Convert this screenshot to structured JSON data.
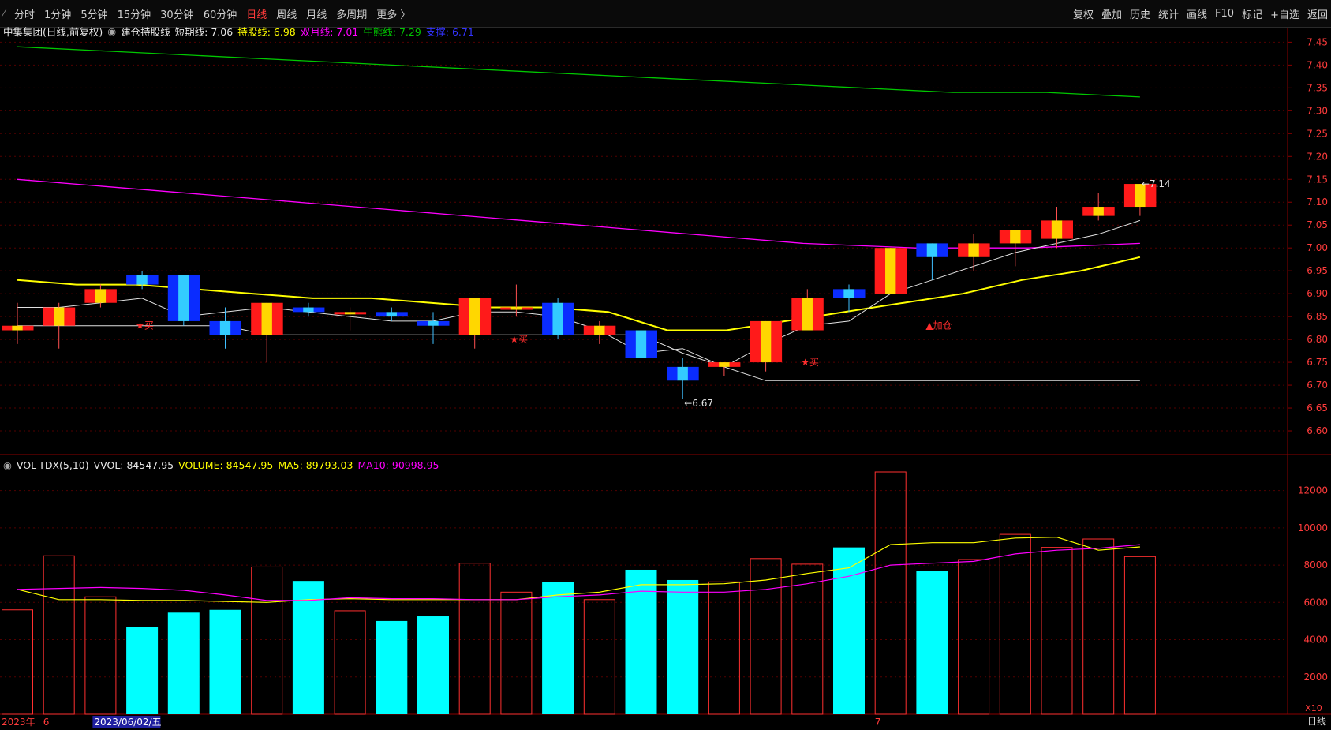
{
  "toolbar": {
    "menu_icon": "pin-icon",
    "left": [
      "分时",
      "1分钟",
      "5分钟",
      "15分钟",
      "30分钟",
      "60分钟",
      "日线",
      "周线",
      "月线",
      "多周期",
      "更多 〉"
    ],
    "active": "日线",
    "right": [
      "复权",
      "叠加",
      "历史",
      "统计",
      "画线",
      "F10",
      "标记",
      "+自选",
      "返回"
    ]
  },
  "price_legend": {
    "name": "中集集团(日线,前复权)",
    "indicator": "建仓持股线",
    "short": "短期线: 7.06",
    "hold": "持股线: 6.98",
    "double_month": "双月线: 7.01",
    "bull": "牛熊线: 7.29",
    "support": "支撑: 6.71"
  },
  "vol_legend": {
    "name": "VOL-TDX(5,10)",
    "vvol": "VVOL: 84547.95",
    "volume": "VOLUME: 84547.95",
    "ma5": "MA5: 89793.03",
    "ma10": "MA10: 90998.95"
  },
  "colors": {
    "up": "#ff2d2d",
    "down": "#00ffff",
    "yellow": "#ffff00",
    "magenta": "#ff00ff",
    "green": "#00c800",
    "blue": "#3333ff",
    "white": "#e0e0e0",
    "grid": "#8b0000"
  },
  "chart_data": {
    "type": "candlestick",
    "ylim": [
      6.55,
      7.48
    ],
    "y_ticks": [
      "7.45",
      "7.40",
      "7.35",
      "7.30",
      "7.25",
      "7.20",
      "7.15",
      "7.10",
      "7.05",
      "7.00",
      "6.95",
      "6.90",
      "6.85",
      "6.80",
      "6.75",
      "6.70",
      "6.65",
      "6.60"
    ],
    "candles": [
      {
        "o": 6.82,
        "c": 6.83,
        "h": 6.88,
        "l": 6.79
      },
      {
        "o": 6.83,
        "c": 6.87,
        "h": 6.88,
        "l": 6.78
      },
      {
        "o": 6.88,
        "c": 6.91,
        "h": 6.92,
        "l": 6.87
      },
      {
        "o": 6.94,
        "c": 6.92,
        "h": 6.95,
        "l": 6.91
      },
      {
        "o": 6.94,
        "c": 6.84,
        "h": 6.94,
        "l": 6.83
      },
      {
        "o": 6.84,
        "c": 6.81,
        "h": 6.87,
        "l": 6.78
      },
      {
        "o": 6.81,
        "c": 6.88,
        "h": 6.88,
        "l": 6.75
      },
      {
        "o": 6.87,
        "c": 6.86,
        "h": 6.88,
        "l": 6.85
      },
      {
        "o": 6.86,
        "c": 6.86,
        "h": 6.87,
        "l": 6.82
      },
      {
        "o": 6.86,
        "c": 6.85,
        "h": 6.87,
        "l": 6.84
      },
      {
        "o": 6.84,
        "c": 6.83,
        "h": 6.86,
        "l": 6.79
      },
      {
        "o": 6.81,
        "c": 6.89,
        "h": 6.89,
        "l": 6.78
      },
      {
        "o": 6.87,
        "c": 6.87,
        "h": 6.92,
        "l": 6.85
      },
      {
        "o": 6.88,
        "c": 6.81,
        "h": 6.89,
        "l": 6.8
      },
      {
        "o": 6.81,
        "c": 6.83,
        "h": 6.84,
        "l": 6.79
      },
      {
        "o": 6.82,
        "c": 6.76,
        "h": 6.84,
        "l": 6.75
      },
      {
        "o": 6.74,
        "c": 6.71,
        "h": 6.76,
        "l": 6.67
      },
      {
        "o": 6.74,
        "c": 6.75,
        "h": 6.75,
        "l": 6.72
      },
      {
        "o": 6.75,
        "c": 6.84,
        "h": 6.84,
        "l": 6.73
      },
      {
        "o": 6.82,
        "c": 6.89,
        "h": 6.91,
        "l": 6.82
      },
      {
        "o": 6.91,
        "c": 6.89,
        "h": 6.92,
        "l": 6.86
      },
      {
        "o": 6.9,
        "c": 7.0,
        "h": 7.0,
        "l": 6.9
      },
      {
        "o": 7.01,
        "c": 6.98,
        "h": 7.01,
        "l": 6.93
      },
      {
        "o": 6.98,
        "c": 7.01,
        "h": 7.03,
        "l": 6.95
      },
      {
        "o": 7.01,
        "c": 7.04,
        "h": 7.04,
        "l": 6.96
      },
      {
        "o": 7.02,
        "c": 7.06,
        "h": 7.09,
        "l": 7.0
      },
      {
        "o": 7.07,
        "c": 7.09,
        "h": 7.12,
        "l": 7.06
      },
      {
        "o": 7.09,
        "c": 7.14,
        "h": 7.14,
        "l": 7.07
      }
    ],
    "lines": {
      "bull": [
        7.44,
        7.43,
        7.42,
        7.41,
        7.4,
        7.39,
        7.38,
        7.37,
        7.36,
        7.35,
        7.34,
        7.34,
        7.33
      ],
      "double_month": [
        7.15,
        7.13,
        7.11,
        7.09,
        7.07,
        7.05,
        7.03,
        7.01,
        7.0,
        7.0,
        7.01
      ],
      "hold": [
        6.93,
        6.92,
        6.92,
        6.91,
        6.9,
        6.89,
        6.89,
        6.88,
        6.87,
        6.87,
        6.86,
        6.82,
        6.82,
        6.84,
        6.86,
        6.88,
        6.9,
        6.93,
        6.95,
        6.98
      ],
      "short": [
        6.87,
        6.87,
        6.88,
        6.89,
        6.85,
        6.86,
        6.87,
        6.86,
        6.85,
        6.84,
        6.84,
        6.86,
        6.86,
        6.85,
        6.82,
        6.77,
        6.78,
        6.74,
        6.79,
        6.83,
        6.84,
        6.9,
        6.93,
        6.96,
        6.99,
        7.01,
        7.03,
        7.06
      ],
      "support": [
        6.83,
        6.83,
        6.83,
        6.83,
        6.83,
        6.83,
        6.81,
        6.81,
        6.81,
        6.81,
        6.81,
        6.81,
        6.81,
        6.81,
        6.81,
        6.81,
        6.77,
        6.74,
        6.71,
        6.71,
        6.71,
        6.71,
        6.71,
        6.71,
        6.71,
        6.71,
        6.71,
        6.71
      ]
    },
    "annotations": [
      {
        "text": "★买",
        "i": 3,
        "y": 6.83,
        "color": "#ff2d2d"
      },
      {
        "text": "★买",
        "i": 12,
        "y": 6.8,
        "color": "#ff2d2d"
      },
      {
        "text": "★买",
        "i": 19,
        "y": 6.75,
        "color": "#ff2d2d"
      },
      {
        "text": "▲加仓",
        "i": 22,
        "y": 6.83,
        "color": "#ff2d2d"
      },
      {
        "text": "←6.67",
        "i": 16,
        "y": 6.66,
        "color": "#e0e0e0"
      },
      {
        "text": "←7.14",
        "i": 27,
        "y": 7.14,
        "color": "#e0e0e0"
      }
    ],
    "volume": {
      "ylim": [
        0,
        13000
      ],
      "y_ticks": [
        "12000",
        "10000",
        "8000",
        "6000",
        "4000",
        "2000"
      ],
      "scale_label": "X10",
      "values": [
        5600,
        8500,
        6300,
        4700,
        5450,
        5600,
        7900,
        7150,
        5550,
        5000,
        5250,
        8100,
        6550,
        7100,
        6150,
        7750,
        7200,
        7100,
        8350,
        8050,
        8950,
        13000,
        7700,
        8300,
        9650,
        8950,
        9400,
        8454.795
      ],
      "ma5": [
        6700,
        6150,
        6150,
        6100,
        6100,
        6050,
        6000,
        6150,
        6200,
        6150,
        6150,
        6150,
        6150,
        6400,
        6550,
        6950,
        6950,
        7000,
        7200,
        7550,
        7850,
        9100,
        9200,
        9200,
        9450,
        9500,
        8800,
        8979.303
      ],
      "ma10": [
        6700,
        6750,
        6800,
        6750,
        6650,
        6400,
        6100,
        6100,
        6250,
        6200,
        6200,
        6150,
        6150,
        6300,
        6400,
        6600,
        6550,
        6550,
        6700,
        7000,
        7400,
        8000,
        8100,
        8200,
        8600,
        8800,
        8900,
        9099.895
      ]
    },
    "x_labels": [
      {
        "text": "2023年",
        "i": 0
      },
      {
        "text": "6",
        "i": 1
      },
      {
        "text": "2023/06/02/五",
        "i": 2
      },
      {
        "text": "7",
        "i": 21
      }
    ],
    "period_label": "日线"
  }
}
